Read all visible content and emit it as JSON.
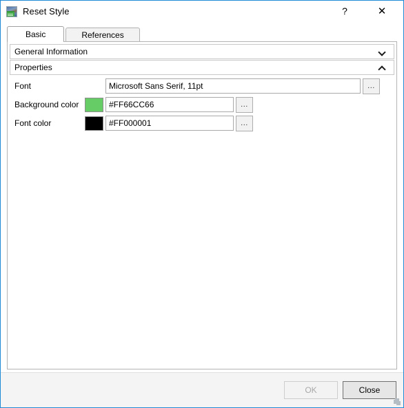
{
  "window": {
    "title": "Reset Style",
    "icon": "style-image-icon",
    "border_color": "#1E8AD6",
    "caption_buttons": [
      {
        "name": "help-button",
        "glyph": "?"
      },
      {
        "name": "close-button",
        "glyph": "✕"
      }
    ]
  },
  "tabs": [
    {
      "label": "Basic",
      "active": true
    },
    {
      "label": "References",
      "active": false
    }
  ],
  "groups": [
    {
      "label": "General Information",
      "expanded": false,
      "chevron": "chevron-down-icon"
    },
    {
      "label": "Properties",
      "expanded": true,
      "chevron": "chevron-up-icon"
    }
  ],
  "properties": [
    {
      "label": "Font",
      "value": "Microsoft Sans Serif, 11pt",
      "placeholder": "",
      "browse_label": "...",
      "swatch": null
    },
    {
      "label": "Background color",
      "value": "#FF66CC66",
      "placeholder": "",
      "browse_label": "...",
      "swatch": "#66CC66"
    },
    {
      "label": "Font color",
      "value": "#FF000001",
      "placeholder": "",
      "browse_label": "...",
      "swatch": "#000001"
    }
  ],
  "footer": {
    "ok_label": "OK",
    "ok_enabled": false,
    "close_label": "Close",
    "close_default": true
  }
}
